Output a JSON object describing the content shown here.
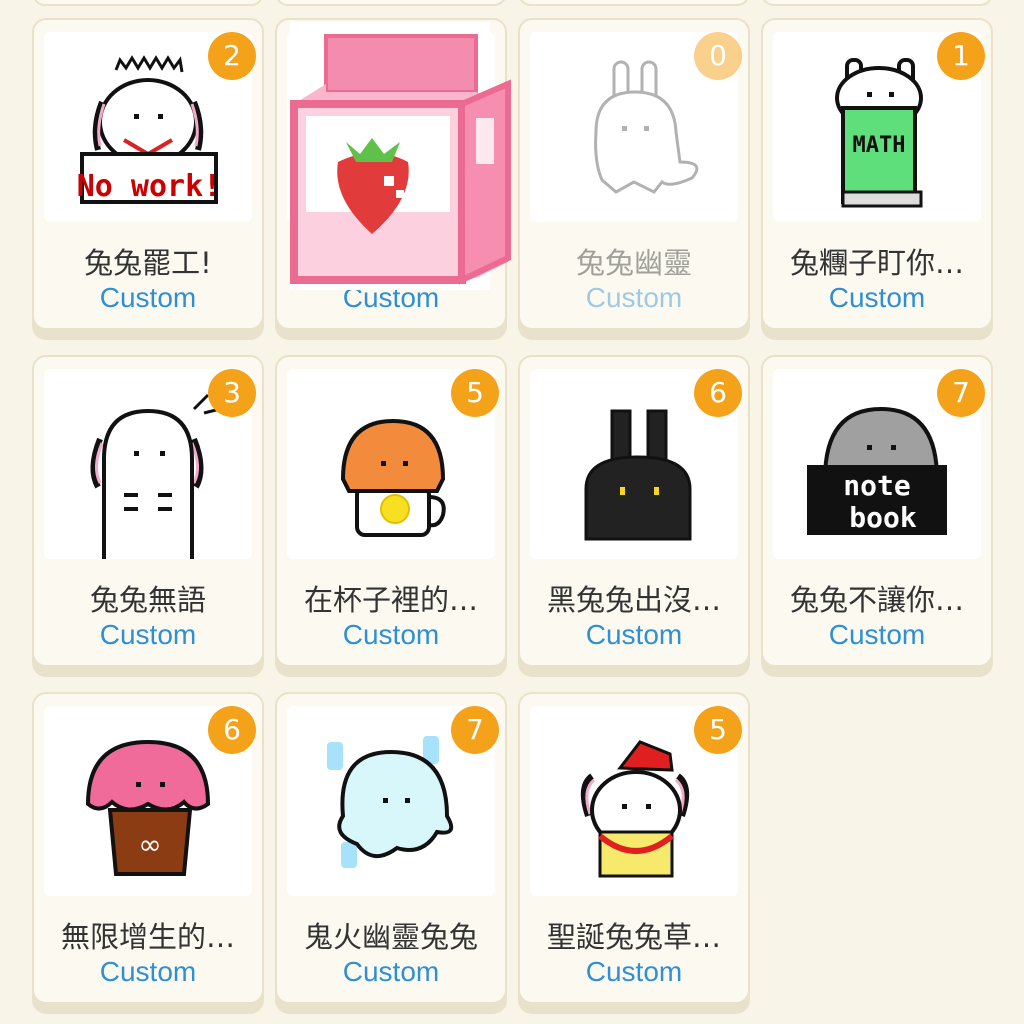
{
  "stickers": [
    {
      "title": "兔兔罷工!",
      "badge": "2",
      "action": "Custom"
    },
    {
      "title": "",
      "badge": "",
      "action": "Custom"
    },
    {
      "title": "兔兔幽靈",
      "badge": "0",
      "action": "Custom"
    },
    {
      "title": "兔糰子盯你…",
      "badge": "1",
      "action": "Custom"
    },
    {
      "title": "兔兔無語",
      "badge": "3",
      "action": "Custom"
    },
    {
      "title": "在杯子裡的…",
      "badge": "5",
      "action": "Custom"
    },
    {
      "title": "黑兔兔出沒…",
      "badge": "6",
      "action": "Custom"
    },
    {
      "title": "兔兔不讓你…",
      "badge": "7",
      "action": "Custom"
    },
    {
      "title": "無限增生的…",
      "badge": "6",
      "action": "Custom"
    },
    {
      "title": "鬼火幽靈兔兔",
      "badge": "7",
      "action": "Custom"
    },
    {
      "title": "聖誕兔兔草…",
      "badge": "5",
      "action": "Custom"
    }
  ],
  "art_text": {
    "no_work": "No work!",
    "math": "MATH",
    "notebook_1": "note",
    "notebook_2": "book"
  },
  "colors": {
    "badge": "#f5a21b",
    "custom_link": "#2f8fd5",
    "background": "#f8f5e8",
    "card_border": "#e9e1c8"
  }
}
